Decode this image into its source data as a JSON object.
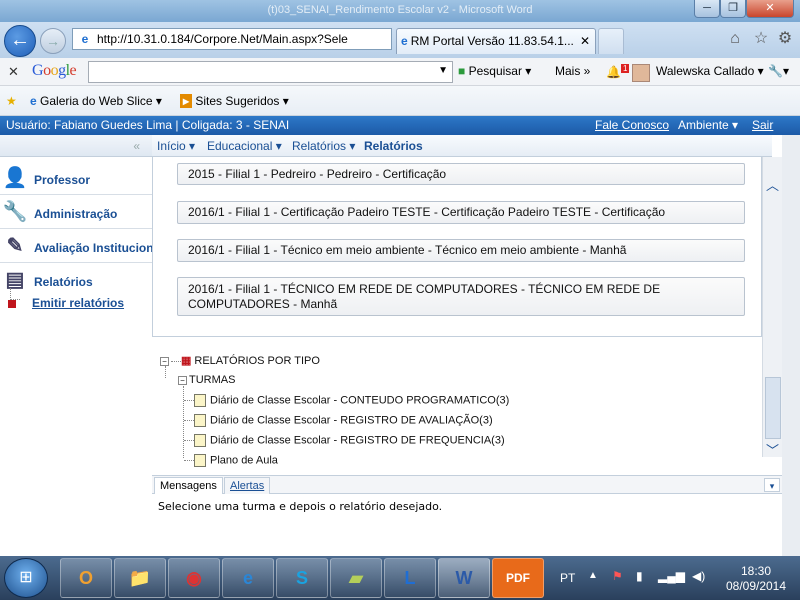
{
  "window": {
    "title": "(t)03_SENAI_Rendimento Escolar v2 - Microsoft Word",
    "btn_min": "─",
    "btn_max": "❐",
    "btn_close": "✕"
  },
  "browser": {
    "back_glyph": "←",
    "forward_glyph": "→",
    "address": "http://10.31.0.184/Corpore.Net/Main.aspx?Sele",
    "address_controls": "🔍 ▾ ✕ ↻",
    "tab_title": "RM Portal Versão 11.83.54.1...",
    "tab_close": "✕",
    "icons": {
      "home": "⌂",
      "favorites": "☆",
      "settings": "⚙"
    }
  },
  "google_bar": {
    "close": "✕",
    "logo": "Google",
    "search_placeholder": "",
    "pesquisar": "Pesquisar ▾",
    "mais": "Mais »",
    "notif_count": "1",
    "user": "Walewska Callado ▾",
    "wrench": "🔧▾"
  },
  "favorites_bar": {
    "star": "★",
    "items": [
      "Galeria do Web Slice ▾",
      "Sites Sugeridos ▾"
    ]
  },
  "user_bar": {
    "user_text": "Usuário: Fabiano Guedes Lima  |  Coligada: 3 - SENAI",
    "fale_conosco": "Fale Conosco",
    "ambiente": "Ambiente ▾",
    "sair": "Sair"
  },
  "sidebar": {
    "collapse_glyph": "«",
    "items": [
      {
        "label": "Professor",
        "icon": "person-icon",
        "glyph": "👤"
      },
      {
        "label": "Administração",
        "icon": "wrench-icon",
        "glyph": "🔧"
      },
      {
        "label": "Avaliação Institucional",
        "icon": "pencil-icon",
        "glyph": "✎"
      },
      {
        "label": "Relatórios",
        "icon": "report-icon",
        "glyph": "▤"
      }
    ],
    "sub_item": "Emitir relatórios"
  },
  "breadcrumb": {
    "items": [
      "Início ▾",
      "Educacional ▾",
      "Relatórios ▾"
    ],
    "current": "Relatórios"
  },
  "turmas": [
    "2015 - Filial 1 - Pedreiro - Pedreiro - Certificação",
    "2016/1 - Filial 1 - Certificação Padeiro TESTE - Certificação Padeiro TESTE - Certificação",
    "2016/1 - Filial 1 - Técnico em meio ambiente - Técnico em meio ambiente - Manhã",
    "2016/1 - Filial 1 - TÉCNICO EM REDE DE COMPUTADORES - TÉCNICO EM REDE DE COMPUTADORES - Manhã"
  ],
  "report_tree": {
    "root": "RELATÓRIOS POR TIPO",
    "group": "TURMAS",
    "reports": [
      "Diário de Classe Escolar - CONTEUDO PROGRAMATICO(3)",
      "Diário de Classe Escolar - REGISTRO DE AVALIAÇÃO(3)",
      "Diário de Classe Escolar - REGISTRO DE FREQUENCIA(3)",
      "Plano de Aula"
    ]
  },
  "messages": {
    "tabs": [
      "Mensagens",
      "Alertas"
    ],
    "text": "Selecione uma turma e depois o relatório desejado.",
    "caret": "▾"
  },
  "taskbar": {
    "start": "⊞",
    "apps": [
      {
        "name": "outlook",
        "glyph": "O",
        "color": "#f0a030"
      },
      {
        "name": "explorer",
        "glyph": "📁",
        "color": "#e8c25a"
      },
      {
        "name": "chrome",
        "glyph": "◉",
        "color": "#d33"
      },
      {
        "name": "ie",
        "glyph": "e",
        "color": "#2b86d6"
      },
      {
        "name": "skype",
        "glyph": "S",
        "color": "#1aa3e0"
      },
      {
        "name": "notes",
        "glyph": "▰",
        "color": "#b4cf5a"
      },
      {
        "name": "lync",
        "glyph": "L",
        "color": "#1f6ed4"
      },
      {
        "name": "word",
        "glyph": "W",
        "color": "#2b5aa8"
      },
      {
        "name": "pdf",
        "glyph": "PDF",
        "color": "#e86a1a"
      }
    ],
    "lang": "PT",
    "time": "18:30",
    "date": "08/09/2014"
  }
}
